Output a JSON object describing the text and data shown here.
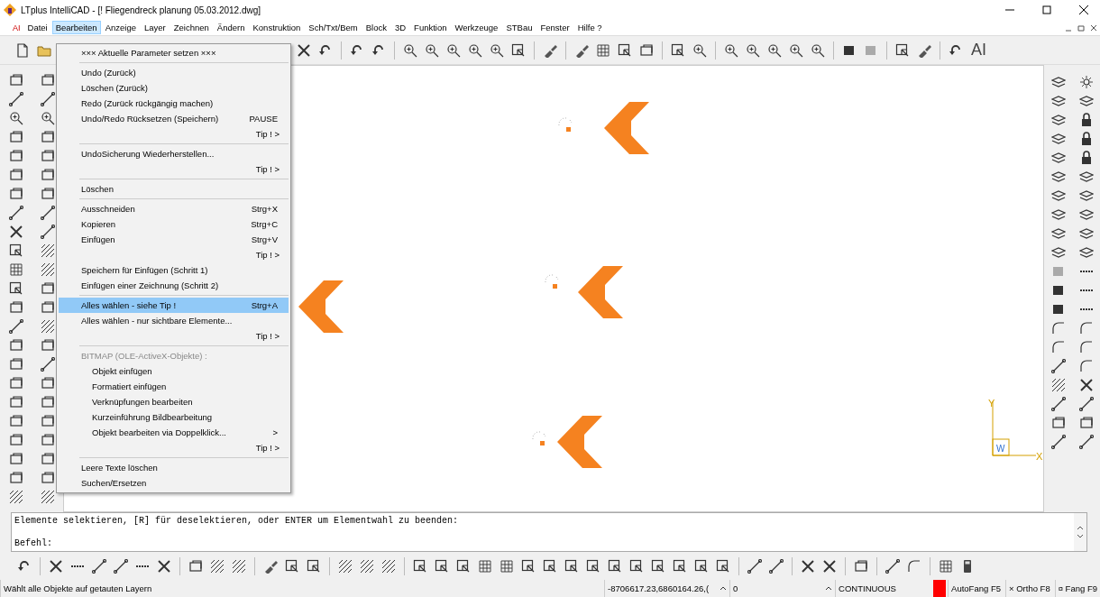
{
  "window": {
    "title": "LTplus IntelliCAD - [! Fliegendreck planung 05.03.2012.dwg]"
  },
  "menu_bar": {
    "logo": "AI",
    "items": [
      {
        "label": "Datei",
        "selected": false
      },
      {
        "label": "Bearbeiten",
        "selected": true
      },
      {
        "label": "Anzeige",
        "selected": false
      },
      {
        "label": "Layer",
        "selected": false
      },
      {
        "label": "Zeichnen",
        "selected": false
      },
      {
        "label": "Ändern",
        "selected": false
      },
      {
        "label": "Konstruktion",
        "selected": false
      },
      {
        "label": "Sch/Txt/Bem",
        "selected": false
      },
      {
        "label": "Block",
        "selected": false
      },
      {
        "label": "3D",
        "selected": false
      },
      {
        "label": "Funktion",
        "selected": false
      },
      {
        "label": "Werkzeuge",
        "selected": false
      },
      {
        "label": "STBau",
        "selected": false
      },
      {
        "label": "Fenster",
        "selected": false
      },
      {
        "label": "Hilfe ?",
        "selected": false
      }
    ]
  },
  "toolbar": {
    "logo": "AI"
  },
  "dropdown": [
    {
      "kind": "item",
      "label": "××× Aktuelle Parameter setzen ×××",
      "selected": false,
      "disabled": false
    },
    {
      "kind": "separator"
    },
    {
      "kind": "item",
      "label": "Undo (Zurück)",
      "selected": false,
      "disabled": false
    },
    {
      "kind": "item",
      "label": "Löschen (Zurück)",
      "selected": false,
      "disabled": false
    },
    {
      "kind": "item",
      "label": "Redo (Zurück rückgängig machen)",
      "selected": false,
      "disabled": false
    },
    {
      "kind": "item",
      "label": "Undo/Redo Rücksetzen (Speichern)",
      "shortcut": "PAUSE",
      "selected": false,
      "disabled": false
    },
    {
      "kind": "tip",
      "label": "Tip ! >"
    },
    {
      "kind": "separator"
    },
    {
      "kind": "item",
      "label": "UndoSicherung Wiederherstellen...",
      "selected": false,
      "disabled": false
    },
    {
      "kind": "tip",
      "label": "Tip ! >"
    },
    {
      "kind": "separator"
    },
    {
      "kind": "item",
      "label": "Löschen",
      "selected": false,
      "disabled": false
    },
    {
      "kind": "separator"
    },
    {
      "kind": "item",
      "label": "Ausschneiden",
      "shortcut": "Strg+X",
      "selected": false,
      "disabled": false
    },
    {
      "kind": "item",
      "label": "Kopieren",
      "shortcut": "Strg+C",
      "selected": false,
      "disabled": false
    },
    {
      "kind": "item",
      "label": "Einfügen",
      "shortcut": "Strg+V",
      "selected": false,
      "disabled": false
    },
    {
      "kind": "tip",
      "label": "Tip ! >"
    },
    {
      "kind": "item",
      "label": "Speichern für Einfügen (Schritt 1)",
      "selected": false,
      "disabled": false
    },
    {
      "kind": "item",
      "label": "Einfügen einer Zeichnung (Schritt 2)",
      "selected": false,
      "disabled": false
    },
    {
      "kind": "separator"
    },
    {
      "kind": "item",
      "label": "Alles wählen - siehe Tip !",
      "shortcut": "Strg+A",
      "selected": true,
      "disabled": false
    },
    {
      "kind": "item",
      "label": "Alles wählen - nur sichtbare Elemente...",
      "selected": false,
      "disabled": false
    },
    {
      "kind": "tip",
      "label": "Tip ! >"
    },
    {
      "kind": "separator"
    },
    {
      "kind": "item",
      "label": "BITMAP (OLE-ActiveX-Objekte) :",
      "selected": false,
      "disabled": true
    },
    {
      "kind": "subitem",
      "label": "Objekt einfügen",
      "selected": false,
      "disabled": false
    },
    {
      "kind": "subitem",
      "label": "Formatiert einfügen",
      "selected": false,
      "disabled": false
    },
    {
      "kind": "subitem",
      "label": "Verknüpfungen bearbeiten",
      "selected": false,
      "disabled": false
    },
    {
      "kind": "subitem",
      "label": "Kurzeinführung Bildbearbeitung",
      "selected": false,
      "disabled": false
    },
    {
      "kind": "subitem",
      "label": "Objekt bearbeiten via Doppelklick...",
      "shortcut": ">",
      "selected": false,
      "disabled": false
    },
    {
      "kind": "tip",
      "label": "Tip ! >"
    },
    {
      "kind": "separator"
    },
    {
      "kind": "item",
      "label": "Leere Texte löschen",
      "selected": false,
      "disabled": false
    },
    {
      "kind": "item",
      "label": "Suchen/Ersetzen",
      "selected": false,
      "disabled": false
    }
  ],
  "canvas": {
    "ucs": {
      "y_label": "Y",
      "origin_label": "W",
      "x_label": "X"
    }
  },
  "command_line": {
    "lines": [
      "Elemente selektieren, [R] für deselektieren, oder ENTER um Elementwahl zu beenden:",
      "Befehl:"
    ]
  },
  "status_bar": {
    "message": "Wählt alle Objekte auf getauten Layern",
    "coordinates": "-8706617.23,6860164.26,(",
    "layer": "0",
    "linetype": "CONTINUOUS",
    "color": "#ff0000",
    "toggles": [
      "AutoFang F5",
      "× Ortho F8",
      "¤ Fang  F9"
    ]
  }
}
